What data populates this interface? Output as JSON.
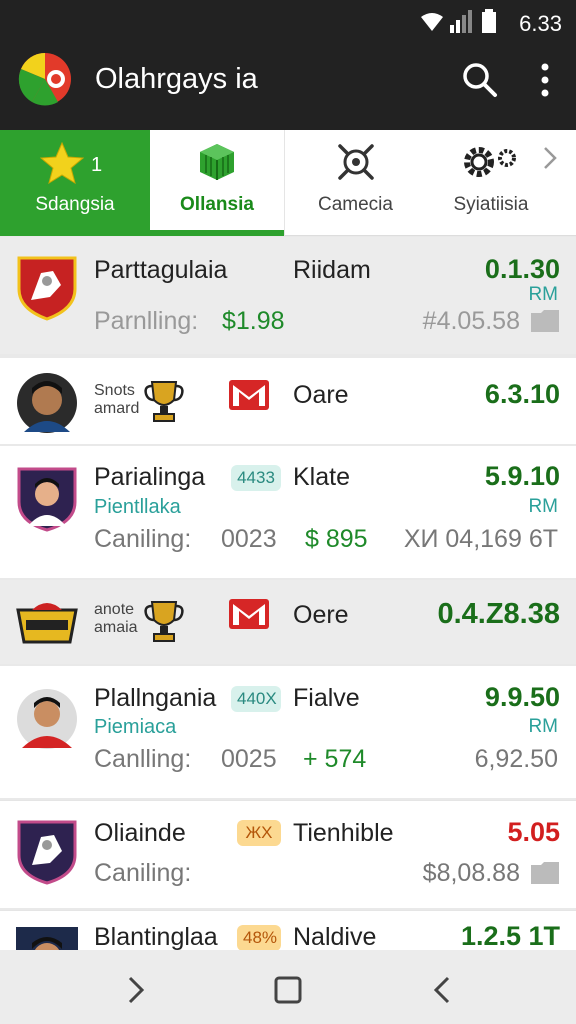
{
  "status": {
    "time": "6.33"
  },
  "appbar": {
    "title": "Olahrgays ia"
  },
  "tabs": [
    {
      "label": "Sdangsia",
      "count": "1"
    },
    {
      "label": "Ollansia"
    },
    {
      "label": "Camecia"
    },
    {
      "label": "Syiatiisia"
    }
  ],
  "rows": [
    {
      "name": "Parttagulaia",
      "opponent": "Riidam",
      "score": "0.1.30",
      "unit": "RM",
      "caption": "Parnlling:",
      "price": "$1.98",
      "extra": "#4.05.58"
    },
    {
      "small_line1": "Snots",
      "small_line2": "amard",
      "opponent": "Oare",
      "score": "6.3.10"
    },
    {
      "name": "Parialinga",
      "pill": "4433",
      "opponent": "Klate",
      "score": "5.9.10",
      "unit": "RM",
      "subtitle": "Pientllaka",
      "caption": "Caniling:",
      "number": "0023",
      "price": "$ 895",
      "extra": "XИ 04,169 6T"
    },
    {
      "small_line1": "anote",
      "small_line2": "amaia",
      "opponent": "Oere",
      "score": "0.4.Z8.38"
    },
    {
      "name": "Plallngania",
      "pill": "440X",
      "opponent": "Fialve",
      "score": "9.9.50",
      "unit": "RM",
      "subtitle": "Piemiaca",
      "caption": "Canlling:",
      "number": "0025",
      "price": "+ 574",
      "extra": "6,92.50"
    },
    {
      "name": "Oliainde",
      "pill": "ЖX",
      "opponent": "Tienhible",
      "score": "5.05",
      "caption": "Caniling:",
      "extra": "$8,08.88"
    },
    {
      "name": "Blantinglaa",
      "pill": "48%",
      "opponent": "Naldive",
      "score": "1.2.5 1T"
    }
  ],
  "colors": {
    "accent": "#2ea12e",
    "teal": "#2aa09a",
    "red": "#d21f1f"
  }
}
